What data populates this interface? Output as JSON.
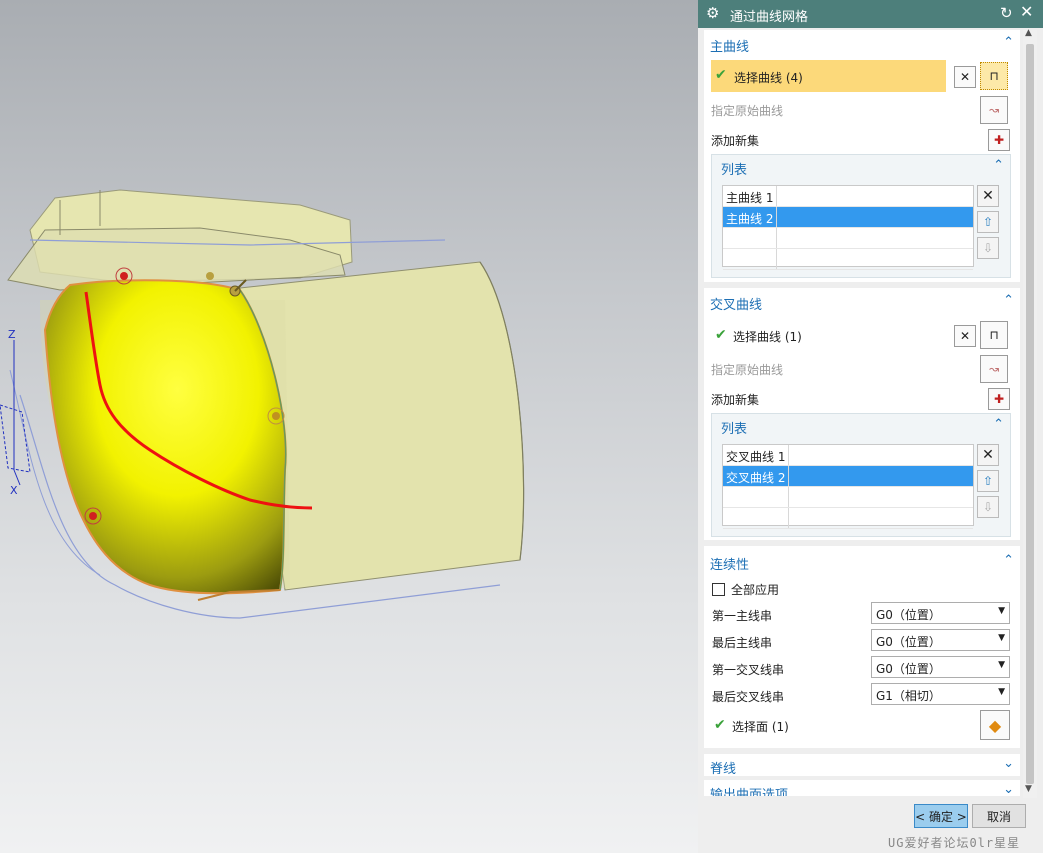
{
  "dialog": {
    "title": "通过曲线网格",
    "main_curves": {
      "header": "主曲线",
      "select_label": "选择曲线 (4)",
      "specify_origin": "指定原始曲线",
      "add_new_set": "添加新集",
      "list": {
        "header": "列表",
        "rows": [
          "主曲线 1",
          "主曲线 2"
        ],
        "selected_index": 1
      }
    },
    "cross_curves": {
      "header": "交叉曲线",
      "select_label": "选择曲线 (1)",
      "specify_origin": "指定原始曲线",
      "add_new_set": "添加新集",
      "list": {
        "header": "列表",
        "rows": [
          "交叉曲线 1",
          "交叉曲线 2"
        ],
        "selected_index": 1
      }
    },
    "continuity": {
      "header": "连续性",
      "apply_all": "全部应用",
      "rows": [
        {
          "label": "第一主线串",
          "value": "G0（位置）"
        },
        {
          "label": "最后主线串",
          "value": "G0（位置）"
        },
        {
          "label": "第一交叉线串",
          "value": "G0（位置）"
        },
        {
          "label": "最后交叉线串",
          "value": "G1（相切）"
        }
      ],
      "select_face": "选择面 (1)"
    },
    "spine": {
      "header": "脊线"
    },
    "output_options": {
      "header": "输出曲面选项"
    },
    "buttons": {
      "ok": "< 确定 >",
      "cancel": "取消"
    }
  },
  "viewport": {
    "axis_z": "Z",
    "axis_x": "X"
  },
  "watermark": "UG爱好者论坛0lr星星",
  "colors": {
    "title_bar": "#4d7f7b",
    "section_header": "#1d6fb4",
    "selection_highlight": "#fcd97a",
    "list_selected": "#3399ee",
    "surface_yellow": "#f2f200"
  }
}
